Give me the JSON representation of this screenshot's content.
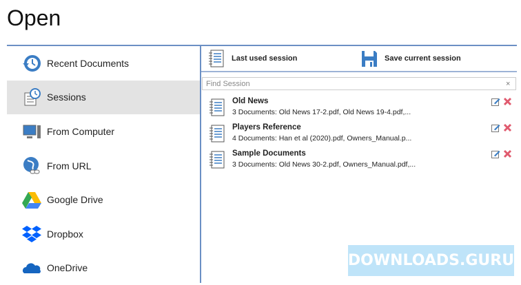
{
  "title": "Open",
  "sidebar": {
    "items": [
      {
        "label": "Recent Documents",
        "icon": "clock-history-icon"
      },
      {
        "label": "Sessions",
        "icon": "sessions-icon",
        "active": true
      },
      {
        "label": "From Computer",
        "icon": "computer-icon"
      },
      {
        "label": "From URL",
        "icon": "globe-link-icon"
      },
      {
        "label": "Google Drive",
        "icon": "google-drive-icon"
      },
      {
        "label": "Dropbox",
        "icon": "dropbox-icon"
      },
      {
        "label": "OneDrive",
        "icon": "onedrive-icon"
      }
    ]
  },
  "toolbar": {
    "last_used": "Last used session",
    "save_current": "Save current session"
  },
  "search": {
    "placeholder": "Find Session",
    "clear": "×"
  },
  "sessions": [
    {
      "name": "Old News",
      "desc": "3 Documents: Old News 17-2.pdf, Old News 19-4.pdf,..."
    },
    {
      "name": "Players Reference",
      "desc": "4 Documents: Han et al (2020).pdf, Owners_Manual.p..."
    },
    {
      "name": "Sample Documents",
      "desc": "3 Documents: Old News 30-2.pdf, Owners_Manual.pdf,..."
    }
  ],
  "watermark": "DOWNLOADS.GURU",
  "colors": {
    "accent": "#6b8fc4",
    "delete": "#e05a6e",
    "icon_blue": "#3b7dc4"
  }
}
